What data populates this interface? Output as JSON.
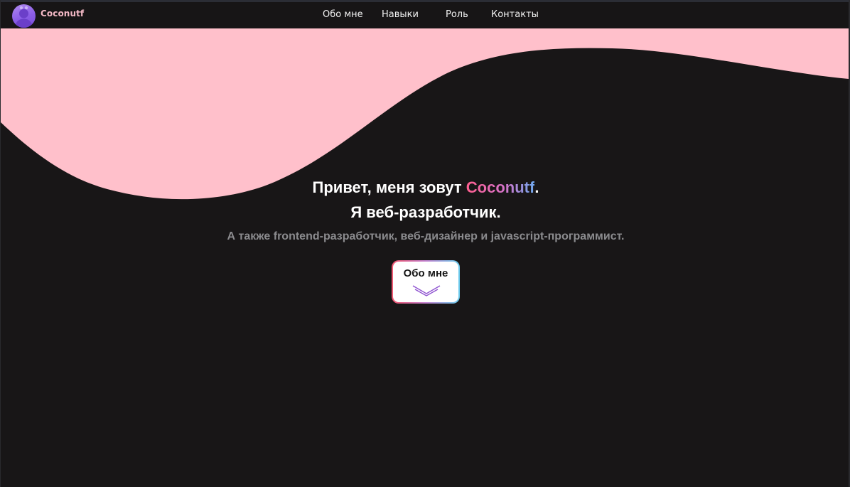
{
  "header": {
    "brand": {
      "name": "Coconutf",
      "avatar_icon": "user-avatar-icon"
    },
    "nav": [
      {
        "label": "Обо мне"
      },
      {
        "label": "Навыки"
      },
      {
        "label": "Роль"
      },
      {
        "label": "Контакты"
      }
    ]
  },
  "hero": {
    "greeting_prefix": "Привет, меня зовут ",
    "name": "Coconutf",
    "greeting_suffix": ".",
    "title": "Я веб-разработчик.",
    "subtitle": "А также frontend-разработчик, веб-дизайнер и javascript-программист.",
    "button": {
      "label": "Обо мне",
      "icon": "chevron-down-icon"
    }
  },
  "colors": {
    "background": "#181617",
    "wave": "#ffc0cb",
    "brand_text": "#f4b9c6",
    "name_gradient": [
      "#ff5f8f",
      "#d772c9",
      "#6fa8ee"
    ],
    "button_border_gradient": [
      "#f0566f",
      "#c786d3",
      "#6ecff0"
    ],
    "subtitle": "#8b8b8e"
  }
}
